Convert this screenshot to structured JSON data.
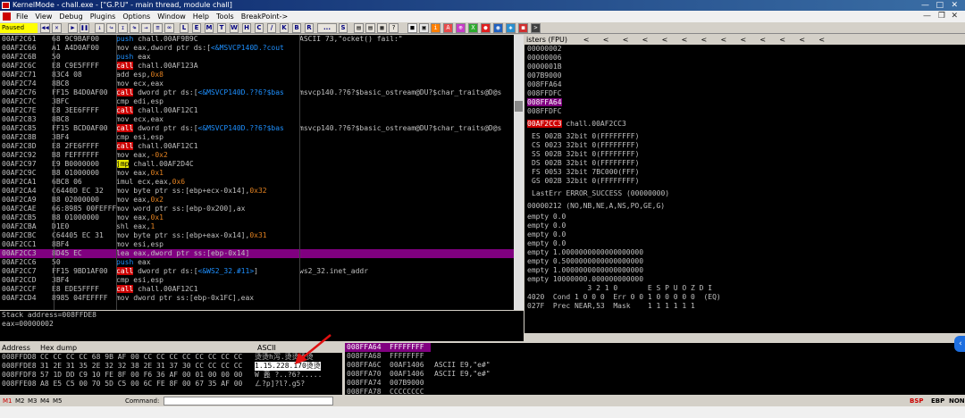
{
  "window": {
    "title": "KernelMode - chall.exe - [\"G.P.U\" - main thread, module chall]"
  },
  "menu": [
    "File",
    "View",
    "Debug",
    "Plugins",
    "Options",
    "Window",
    "Help",
    "Tools",
    "BreakPoint->"
  ],
  "toolbar": {
    "status": "Paused",
    "letters": [
      "L",
      "E",
      "M",
      "T",
      "W",
      "H",
      "C",
      "/",
      "K",
      "B",
      "R",
      "...",
      "S"
    ]
  },
  "disasm": [
    {
      "addr": "00AF2C61",
      "hex": "68 9C9BAF00",
      "instr": [
        {
          "t": "push",
          "c": "push"
        },
        {
          "t": " chall.00AF9B9C"
        }
      ],
      "comment": "ASCII 73,\"ocket() fail:\""
    },
    {
      "addr": "00AF2C66",
      "hex": "A1 A4D0AF00",
      "instr": [
        {
          "t": "mov eax,dword ptr ds:["
        },
        {
          "t": "<&MSVCP140D.?cout",
          "c": "push"
        }
      ],
      "comment": ""
    },
    {
      "addr": "00AF2C6B",
      "hex": "50",
      "instr": [
        {
          "t": "push",
          "c": "push"
        },
        {
          "t": " eax"
        }
      ],
      "comment": ""
    },
    {
      "addr": "00AF2C6C",
      "hex": "E8 C9E5FFFF",
      "instr": [
        {
          "t": "call",
          "c": "call"
        },
        {
          "t": " chall.00AF123A"
        }
      ],
      "comment": ""
    },
    {
      "addr": "00AF2C71",
      "hex": "83C4 08",
      "instr": [
        {
          "t": "add esp,"
        },
        {
          "t": "0x8",
          "c": "imm"
        }
      ],
      "comment": ""
    },
    {
      "addr": "00AF2C74",
      "hex": "8BC8",
      "instr": [
        {
          "t": "mov ecx,eax"
        }
      ],
      "comment": ""
    },
    {
      "addr": "00AF2C76",
      "hex": "FF15 B4D0AF00",
      "instr": [
        {
          "t": "call",
          "c": "call"
        },
        {
          "t": " dword ptr ds:["
        },
        {
          "t": "<&MSVCP140D.??6?$bas",
          "c": "push"
        }
      ],
      "comment": "msvcp140.??6?$basic_ostream@DU?$char_traits@D@s"
    },
    {
      "addr": "00AF2C7C",
      "hex": "3BFC",
      "instr": [
        {
          "t": "cmp edi,esp"
        }
      ],
      "comment": ""
    },
    {
      "addr": "00AF2C7E",
      "hex": "E8 3EE6FFFF",
      "instr": [
        {
          "t": "call",
          "c": "call"
        },
        {
          "t": " chall.00AF12C1"
        }
      ],
      "comment": ""
    },
    {
      "addr": "00AF2C83",
      "hex": "8BC8",
      "instr": [
        {
          "t": "mov ecx,eax"
        }
      ],
      "comment": ""
    },
    {
      "addr": "00AF2C85",
      "hex": "FF15 BCD0AF00",
      "instr": [
        {
          "t": "call",
          "c": "call"
        },
        {
          "t": " dword ptr ds:["
        },
        {
          "t": "<&MSVCP140D.??6?$bas",
          "c": "push"
        }
      ],
      "comment": "msvcp140.??6?$basic_ostream@DU?$char_traits@D@s"
    },
    {
      "addr": "00AF2C8B",
      "hex": "3BF4",
      "instr": [
        {
          "t": "cmp esi,esp"
        }
      ],
      "comment": ""
    },
    {
      "addr": "00AF2C8D",
      "hex": "E8 2FE6FFFF",
      "instr": [
        {
          "t": "call",
          "c": "call"
        },
        {
          "t": " chall.00AF12C1"
        }
      ],
      "comment": ""
    },
    {
      "addr": "00AF2C92",
      "hex": "B8 FEFFFFFF",
      "instr": [
        {
          "t": "mov eax,"
        },
        {
          "t": "-0x2",
          "c": "imm"
        }
      ],
      "comment": ""
    },
    {
      "addr": "00AF2C97",
      "hex": "E9 B0000000",
      "instr": [
        {
          "t": "jmp",
          "c": "jmp"
        },
        {
          "t": " chall.00AF2D4C"
        }
      ],
      "comment": ""
    },
    {
      "addr": "00AF2C9C",
      "hex": "B8 01000000",
      "instr": [
        {
          "t": "mov eax,"
        },
        {
          "t": "0x1",
          "c": "imm"
        }
      ],
      "comment": ""
    },
    {
      "addr": "00AF2CA1",
      "hex": "6BC8 06",
      "instr": [
        {
          "t": "imul ecx,eax,"
        },
        {
          "t": "0x6",
          "c": "imm"
        }
      ],
      "comment": ""
    },
    {
      "addr": "00AF2CA4",
      "hex": "C6440D EC 32",
      "instr": [
        {
          "t": "mov byte ptr ss:[ebp+ecx-0x14],"
        },
        {
          "t": "0x32",
          "c": "imm"
        }
      ],
      "comment": ""
    },
    {
      "addr": "00AF2CA9",
      "hex": "B8 02000000",
      "instr": [
        {
          "t": "mov eax,"
        },
        {
          "t": "0x2",
          "c": "imm"
        }
      ],
      "comment": ""
    },
    {
      "addr": "00AF2CAE",
      "hex": "66:8985 00FEFFF",
      "instr": [
        {
          "t": "mov word ptr ss:[ebp-0x200],ax"
        }
      ],
      "comment": ""
    },
    {
      "addr": "00AF2CB5",
      "hex": "B8 01000000",
      "instr": [
        {
          "t": "mov eax,"
        },
        {
          "t": "0x1",
          "c": "imm"
        }
      ],
      "comment": ""
    },
    {
      "addr": "00AF2CBA",
      "hex": "D1E0",
      "instr": [
        {
          "t": "shl eax,"
        },
        {
          "t": "1",
          "c": "imm"
        }
      ],
      "comment": ""
    },
    {
      "addr": "00AF2CBC",
      "hex": "C64405 EC 31",
      "instr": [
        {
          "t": "mov byte ptr ss:[ebp+eax-0x14],"
        },
        {
          "t": "0x31",
          "c": "imm"
        }
      ],
      "comment": ""
    },
    {
      "addr": "00AF2CC1",
      "hex": "8BF4",
      "instr": [
        {
          "t": "mov esi,esp"
        }
      ],
      "comment": ""
    },
    {
      "addr": "00AF2CC3",
      "hex": "8D45 EC",
      "instr": [
        {
          "t": "lea eax,dword ptr ss:[ebp-0x14]"
        }
      ],
      "comment": "",
      "selected": true
    },
    {
      "addr": "00AF2CC6",
      "hex": "50",
      "instr": [
        {
          "t": "push",
          "c": "push"
        },
        {
          "t": " eax"
        }
      ],
      "comment": ""
    },
    {
      "addr": "00AF2CC7",
      "hex": "FF15 9BD1AF00",
      "instr": [
        {
          "t": "call",
          "c": "call"
        },
        {
          "t": " dword ptr ds:["
        },
        {
          "t": "<&WS2_32.#11>",
          "c": "push"
        },
        {
          "t": "]"
        }
      ],
      "comment": "ws2_32.inet_addr"
    },
    {
      "addr": "00AF2CCD",
      "hex": "3BF4",
      "instr": [
        {
          "t": "cmp esi,esp"
        }
      ],
      "comment": ""
    },
    {
      "addr": "00AF2CCF",
      "hex": "E8 EDE5FFFF",
      "instr": [
        {
          "t": "call",
          "c": "call"
        },
        {
          "t": " chall.00AF12C1"
        }
      ],
      "comment": ""
    },
    {
      "addr": "00AF2CD4",
      "hex": "8985 04FEFFFF",
      "instr": [
        {
          "t": "mov dword ptr ss:[ebp-0x1FC],eax"
        }
      ],
      "comment": ""
    }
  ],
  "info": [
    "Stack address=008FFDE8",
    "eax=00000002"
  ],
  "registers": {
    "header": "isters (FPU)",
    "stack_vals": [
      "00000002",
      "00000006",
      "0000001B",
      "007B9000",
      "008FFA64",
      "008FFDFC"
    ],
    "highlight": "008FFA64",
    "after": [
      "008FFDFC"
    ],
    "eip_label": "00AF2CC3",
    "eip_text": " chall.00AF2CC3",
    "segs": [
      "ES 002B 32bit 0(FFFFFFFF)",
      "CS 0023 32bit 0(FFFFFFFF)",
      "SS 002B 32bit 0(FFFFFFFF)",
      "DS 002B 32bit 0(FFFFFFFF)",
      "FS 0053 32bit 7BC000(FFF)",
      "GS 002B 32bit 0(FFFFFFFF)"
    ],
    "lasterr": "LastErr ERROR_SUCCESS (00000000)",
    "flags": "00000212 (NO,NB,NE,A,NS,PO,GE,G)",
    "fpu": [
      "empty 0.0",
      "empty 0.0",
      "empty 0.0",
      "empty 0.0",
      "empty 1.0000000000000000000",
      "empty 0.5000000000000000000",
      "empty 1.0000000000000000000",
      "empty 10000000.000000000000"
    ],
    "fpu_bits": "              3 2 1 0       E S P U O Z D I",
    "cond": "4020  Cond 1 0 0 0  Err 0 0 1 0 0 0 0 0  (EQ)",
    "prec": "027F  Prec NEAR,53  Mask    1 1 1 1 1 1"
  },
  "dump": {
    "headers": {
      "addr": "Address",
      "hex": "Hex dump",
      "ascii": "ASCII"
    },
    "rows": [
      {
        "addr": "008FFDD8",
        "hex": "CC CC CC CC 68 9B AF 00 CC CC CC CC CC CC CC CC",
        "ascii": "烫烫h泻.烫烫烫烫",
        "hl": false
      },
      {
        "addr": "008FFDE8",
        "hex": "31 2E 31 35 2E 32 32 38 2E 31 37 30 CC CC CC CC",
        "ascii": "1.15.228.170烫烫",
        "hl": true
      },
      {
        "addr": "008FFDF8",
        "hex": "57 1D DD C9 10 FE 8F 00 F6 36 AF 00 01 00 00 00",
        "ascii": "W 蓖 ?..?6?.....",
        "hl": false
      },
      {
        "addr": "008FFE08",
        "hex": "A8 E5 C5 00 70 5D C5 00 6C FE 8F 00 67 35 AF 00",
        "ascii": "ㄥ?p]?l?.g5?",
        "hl": false
      }
    ]
  },
  "stack": [
    {
      "addr": "008FFA64",
      "val": "FFFFFFFF",
      "cmt": "",
      "top": true
    },
    {
      "addr": "008FFA68",
      "val": "FFFFFFFF",
      "cmt": "",
      "top": false
    },
    {
      "addr": "008FFA6C",
      "val": "00AF1406",
      "cmt": "ASCII E9,\"e#\"",
      "top": false
    },
    {
      "addr": "008FFA70",
      "val": "00AF1406",
      "cmt": "ASCII E9,\"e#\"",
      "top": false
    },
    {
      "addr": "008FFA74",
      "val": "007B9000",
      "cmt": "",
      "top": false
    },
    {
      "addr": "008FFA78",
      "val": "CCCCCCCC",
      "cmt": "",
      "top": false
    }
  ],
  "cmdbar": {
    "marks": [
      "M1",
      "M2",
      "M3",
      "M4",
      "M5"
    ],
    "command_label": "Command:",
    "right": [
      "BSP",
      "EBP",
      "NONE"
    ]
  },
  "colors": {
    "accent_purple": "#800080",
    "call_red": "#cc0000",
    "jmp_yellow": "#e8e800",
    "push_blue": "#1e90ff"
  }
}
